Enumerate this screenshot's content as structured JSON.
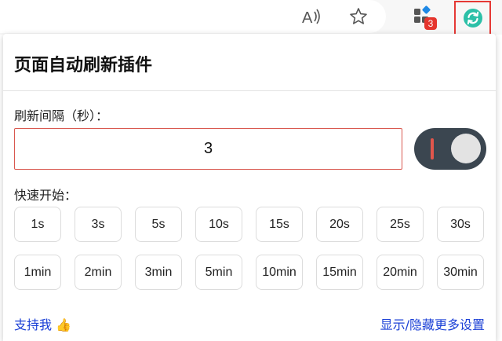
{
  "toolbar": {
    "extensions_badge": "3"
  },
  "popup": {
    "title": "页面自动刷新插件",
    "interval_label": "刷新间隔（秒）：",
    "interval_value": "3",
    "toggle_on": true,
    "quick_start_label": "快速开始：",
    "presets_seconds": [
      "1s",
      "3s",
      "5s",
      "10s",
      "15s",
      "20s",
      "25s",
      "30s"
    ],
    "presets_minutes": [
      "1min",
      "2min",
      "3min",
      "5min",
      "10min",
      "15min",
      "20min",
      "30min"
    ],
    "support_text": "支持我 👍",
    "more_settings_text": "显示/隐藏更多设置"
  },
  "colors": {
    "accent_red": "#e0564c",
    "toggle_bg": "#3b4650",
    "link_blue": "#1a3fd6",
    "extension_teal": "#2cc0a8"
  }
}
